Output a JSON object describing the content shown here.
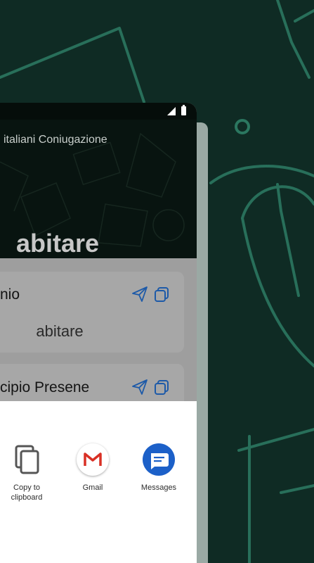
{
  "colors": {
    "background": "#0f2b24",
    "sketch_lines": "#2f7d63",
    "header": "#081410",
    "card": "#a7a7a7",
    "icon_blue": "#1d5aa8",
    "messages_blue": "#1c60c8"
  },
  "header": {
    "app_title": "italiani Coniugazione",
    "verb": "abitare"
  },
  "cards": [
    {
      "title": "nio",
      "value": "abitare",
      "send_icon": "send-icon",
      "copy_icon": "copy-icon"
    },
    {
      "title": "cipio Presene",
      "send_icon": "send-icon",
      "copy_icon": "copy-icon"
    }
  ],
  "share_sheet": {
    "targets": [
      {
        "label": "Copy to clipboard",
        "icon": "copy-clipboard-icon"
      },
      {
        "label": "Gmail",
        "icon": "gmail-icon"
      },
      {
        "label": "Messages",
        "icon": "messages-icon"
      }
    ]
  }
}
